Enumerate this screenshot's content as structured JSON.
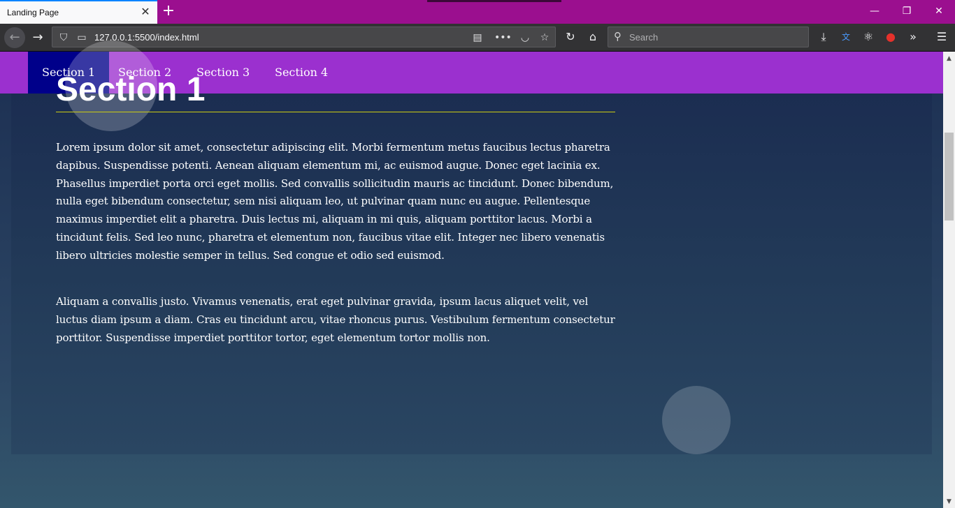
{
  "browser": {
    "tab_title": "Landing Page",
    "tab_close": "✕",
    "new_tab": "+",
    "url": "127.0.0.1:5500/index.html",
    "search_placeholder": "Search",
    "window_controls": {
      "minimize": "—",
      "restore": "❐",
      "close": "✕"
    },
    "icons": {
      "back": "back-arrow-icon",
      "forward": "forward-arrow-icon",
      "shield": "shield-icon",
      "page": "page-icon",
      "reader": "reader-view-icon",
      "more": "more-dots-icon",
      "pocket": "pocket-icon",
      "bookmark": "bookmark-star-icon",
      "reload": "reload-icon",
      "home": "home-icon",
      "search": "search-icon",
      "download": "download-icon",
      "translate": "translate-icon",
      "react": "react-devtools-icon",
      "tomato": "tomato-extension-icon",
      "overflow": "overflow-chevron-icon",
      "menu": "hamburger-menu-icon"
    }
  },
  "site_nav": {
    "items": [
      {
        "label": "Section 1",
        "active": true
      },
      {
        "label": "Section 2",
        "active": false
      },
      {
        "label": "Section 3",
        "active": false
      },
      {
        "label": "Section 4",
        "active": false
      }
    ]
  },
  "section": {
    "heading": "Section 1",
    "paragraphs": [
      "Lorem ipsum dolor sit amet, consectetur adipiscing elit. Morbi fermentum metus faucibus lectus pharetra dapibus. Suspendisse potenti. Aenean aliquam elementum mi, ac euismod augue. Donec eget lacinia ex. Phasellus imperdiet porta orci eget mollis. Sed convallis sollicitudin mauris ac tincidunt. Donec bibendum, nulla eget bibendum consectetur, sem nisi aliquam leo, ut pulvinar quam nunc eu augue. Pellentesque maximus imperdiet elit a pharetra. Duis lectus mi, aliquam in mi quis, aliquam porttitor lacus. Morbi a tincidunt felis. Sed leo nunc, pharetra et elementum non, faucibus vitae elit. Integer nec libero venenatis libero ultricies molestie semper in tellus. Sed congue et odio sed euismod.",
      "Aliquam a convallis justo. Vivamus venenatis, erat eget pulvinar gravida, ipsum lacus aliquet velit, vel luctus diam ipsum a diam. Cras eu tincidunt arcu, vitae rhoncus purus. Vestibulum fermentum consectetur porttitor. Suspendisse imperdiet porttitor tortor, eget elementum tortor mollis non."
    ]
  },
  "colors": {
    "tabbar": "#9b0f8f",
    "site_nav": "#9b30cf",
    "active_nav": "#00008a",
    "heading_underline": "#cccc11"
  }
}
